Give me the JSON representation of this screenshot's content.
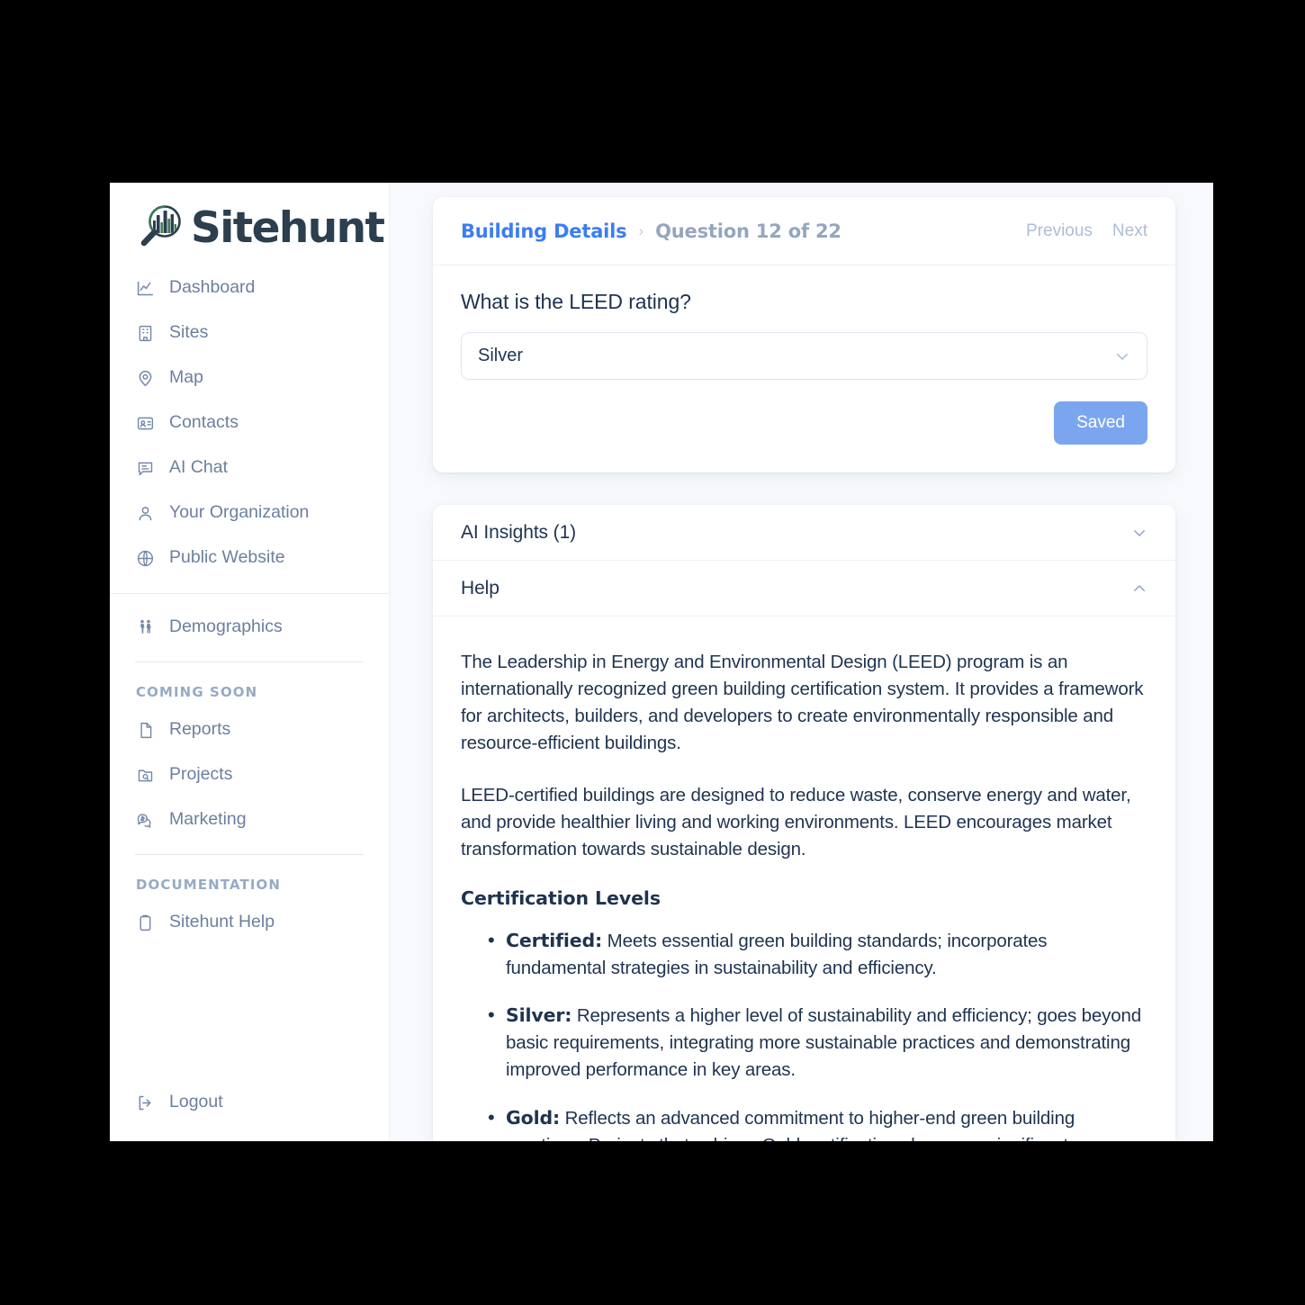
{
  "brand": {
    "name": "Sitehunt",
    "logo_icon": "magnifier-skyline-icon",
    "logo_color": "#2b3f4e"
  },
  "sidebar": {
    "primary_items": [
      {
        "label": "Dashboard",
        "icon": "chart-line-icon"
      },
      {
        "label": "Sites",
        "icon": "building-icon"
      },
      {
        "label": "Map",
        "icon": "map-pin-icon"
      },
      {
        "label": "Contacts",
        "icon": "contact-card-icon"
      },
      {
        "label": "AI Chat",
        "icon": "chat-bubble-icon"
      },
      {
        "label": "Your Organization",
        "icon": "person-icon"
      },
      {
        "label": "Public Website",
        "icon": "globe-icon"
      }
    ],
    "secondary_items": [
      {
        "label": "Demographics",
        "icon": "two-people-icon"
      }
    ],
    "coming_soon_heading": "COMING SOON",
    "coming_soon_items": [
      {
        "label": "Reports",
        "icon": "document-icon"
      },
      {
        "label": "Projects",
        "icon": "folder-search-icon"
      },
      {
        "label": "Marketing",
        "icon": "money-chat-icon"
      }
    ],
    "documentation_heading": "DOCUMENTATION",
    "documentation_items": [
      {
        "label": "Sitehunt Help",
        "icon": "clipboard-icon"
      }
    ],
    "logout": {
      "label": "Logout",
      "icon": "logout-arrow-icon"
    }
  },
  "header": {
    "breadcrumb_link": "Building Details",
    "breadcrumb_separator": "›",
    "breadcrumb_current": "Question 12 of 22",
    "previous_label": "Previous",
    "next_label": "Next",
    "link_color": "#3b7df5"
  },
  "question": {
    "text": "What is the LEED rating?",
    "selected_value": "Silver",
    "dropdown_icon": "chevron-down-icon",
    "save_button_label": "Saved",
    "save_button_color": "#7ba6ef"
  },
  "panels": {
    "ai_insights": {
      "title": "AI Insights (1)",
      "caret": "chevron-down-icon",
      "expanded": false
    },
    "help": {
      "title": "Help",
      "caret": "chevron-up-icon",
      "expanded": true
    }
  },
  "help_content": {
    "paragraph_1": "The Leadership in Energy and Environmental Design (LEED) program is an internationally recognized green building certification system. It provides a framework for architects, builders, and developers to create environmentally responsible and resource-efficient buildings.",
    "paragraph_2": "LEED-certified buildings are designed to reduce waste, conserve energy and water, and provide healthier living and working environments. LEED encourages market transformation towards sustainable design.",
    "subheading": "Certification Levels",
    "levels": [
      {
        "term": "Certified:",
        "description": " Meets essential green building standards; incorporates fundamental strategies in sustainability and efficiency."
      },
      {
        "term": "Silver:",
        "description": " Represents a higher level of sustainability and efficiency; goes beyond basic requirements, integrating more sustainable practices and demonstrating improved performance in key areas."
      },
      {
        "term": "Gold:",
        "description": " Reflects an advanced commitment to higher-end green building practices. Projects that achieve Gold certification showcase significant advancements in sustainable design and construction, with substantial"
      }
    ]
  }
}
